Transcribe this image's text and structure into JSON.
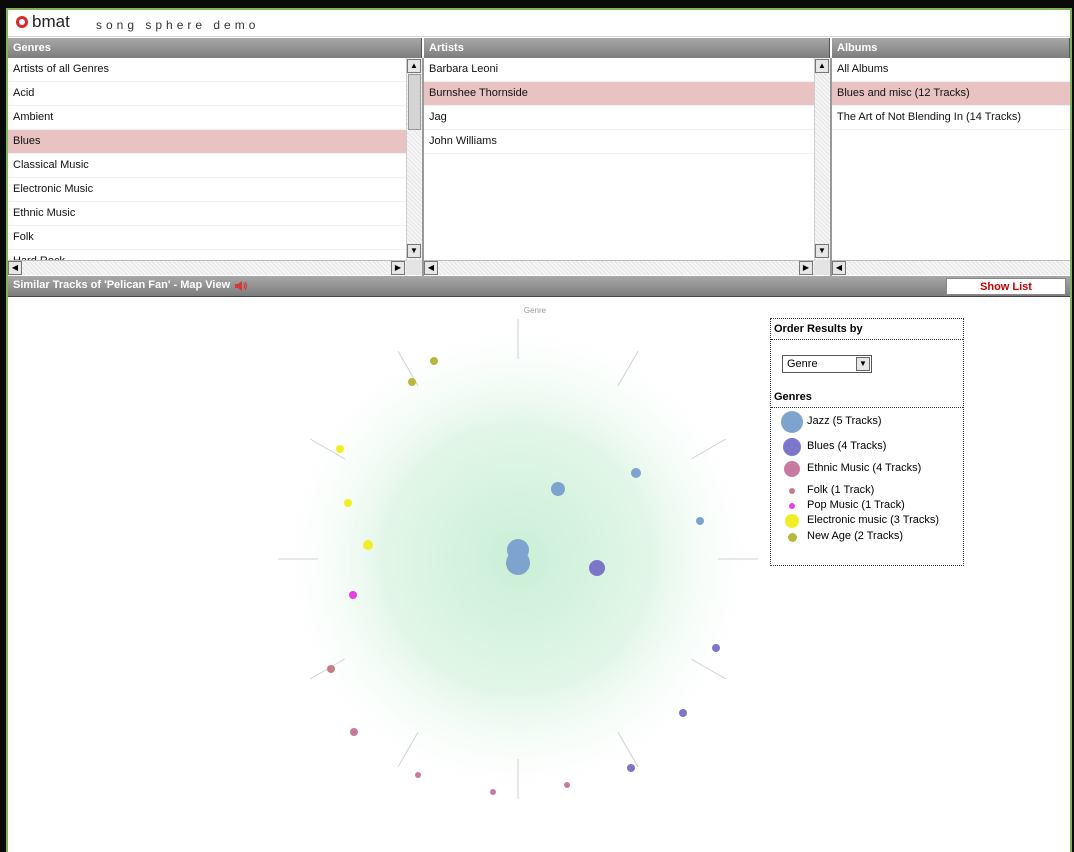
{
  "app": {
    "brand": "bmat",
    "subtitle": "song sphere demo"
  },
  "genres": {
    "header": "Genres",
    "items": [
      "Artists of all Genres",
      "Acid",
      "Ambient",
      "Blues",
      "Classical Music",
      "Electronic Music",
      "Ethnic Music",
      "Folk",
      "Hard Rock"
    ],
    "selected_index": 3
  },
  "artists": {
    "header": "Artists",
    "items": [
      "Barbara Leoni",
      "Burnshee Thornside",
      "Jag",
      "John Williams"
    ],
    "selected_index": 1
  },
  "albums": {
    "header": "Albums",
    "items": [
      "All Albums",
      "Blues and misc (12 Tracks)",
      "The Art of Not Blending In (14 Tracks)"
    ],
    "selected_index": 1
  },
  "section": {
    "title": "Similar Tracks of 'Pelican Fan' - Map View",
    "show_list": "Show List"
  },
  "map": {
    "axis_label": "Genre"
  },
  "legend": {
    "order_header": "Order Results by",
    "order_value": "Genre",
    "genres_header": "Genres",
    "items": [
      {
        "label": "Jazz (5 Tracks)",
        "color": "#7fa3cf"
      },
      {
        "label": "Blues (4 Tracks)",
        "color": "#7c75c9"
      },
      {
        "label": "Ethnic Music (4 Tracks)",
        "color": "#c77aa0"
      },
      {
        "label": "Folk (1 Track)",
        "color": "#c57b86"
      },
      {
        "label": "Pop Music (1 Track)",
        "color": "#e83ee3"
      },
      {
        "label": "Electronic music (3 Tracks)",
        "color": "#f2ee25"
      },
      {
        "label": "New Age (2 Tracks)",
        "color": "#b8b83a"
      }
    ]
  },
  "colors": {
    "selection": "#e9c2c2",
    "header_gray": "#8f8f8f",
    "frame_green": "#7fb35a",
    "glow_green": "#c9efd6",
    "show_list_red": "#c40000"
  }
}
